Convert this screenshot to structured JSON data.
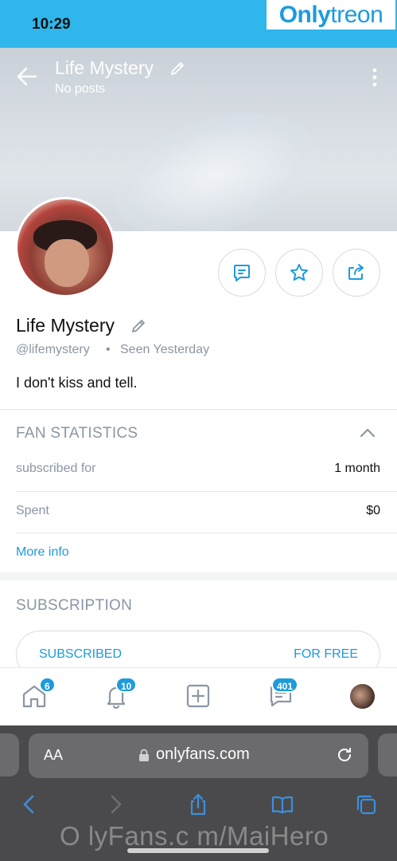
{
  "status_bar": {
    "time": "10:29"
  },
  "watermark": {
    "top_brand_a": "Only",
    "top_brand_b": "treon",
    "bottom": "O lyFans.c m/MaiHero"
  },
  "header": {
    "title": "Life Mystery",
    "subtitle": "No posts"
  },
  "profile": {
    "name": "Life Mystery",
    "handle": "@lifemystery",
    "separator": "•",
    "seen": "Seen Yesterday",
    "bio": "I don't kiss and tell."
  },
  "fan_statistics": {
    "title": "FAN STATISTICS",
    "rows": [
      {
        "label": "subscribed for",
        "value": "1 month"
      },
      {
        "label": "Spent",
        "value": "$0"
      }
    ],
    "more_info": "More info"
  },
  "subscription": {
    "title": "SUBSCRIPTION",
    "status": "SUBSCRIBED",
    "price": "FOR FREE"
  },
  "bottom_nav": {
    "home_badge": "6",
    "notifications_badge": "10",
    "messages_badge": "401"
  },
  "browser": {
    "text_size_label": "AA",
    "url": "onlyfans.com"
  },
  "icons": {
    "back": "back-arrow-icon",
    "edit": "pencil-icon",
    "more": "kebab-icon",
    "message": "message-icon",
    "favorite": "star-icon",
    "share": "share-icon",
    "collapse": "chevron-up-icon",
    "home": "home-icon",
    "notifications": "bell-icon",
    "new_post": "plus-square-icon",
    "messages": "chat-icon"
  },
  "colors": {
    "accent": "#1d9bdc",
    "status_bar": "#2fb7ec",
    "muted_text": "#8a96a3",
    "browser_chrome": "#4a4a4c"
  }
}
